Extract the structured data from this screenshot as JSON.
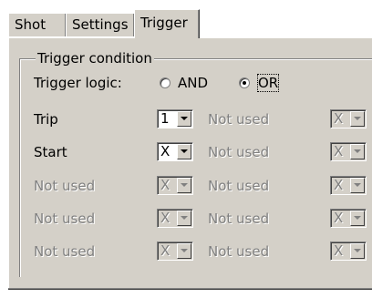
{
  "tabs": [
    {
      "label": "Shot",
      "active": false
    },
    {
      "label": "Settings",
      "active": false
    },
    {
      "label": "Trigger",
      "active": true
    }
  ],
  "group": {
    "title": "Trigger condition",
    "logic_label": "Trigger logic:",
    "logic_options": [
      {
        "label": "AND",
        "selected": false
      },
      {
        "label": "OR",
        "selected": true
      }
    ]
  },
  "rows": [
    {
      "name": "Trip",
      "enabled": true,
      "value": "1",
      "second_label": "Not used",
      "second_value": "X"
    },
    {
      "name": "Start",
      "enabled": true,
      "value": "X",
      "second_label": "Not used",
      "second_value": "X"
    },
    {
      "name": "Not used",
      "enabled": false,
      "value": "X",
      "second_label": "Not used",
      "second_value": "X"
    },
    {
      "name": "Not used",
      "enabled": false,
      "value": "X",
      "second_label": "Not used",
      "second_value": "X"
    },
    {
      "name": "Not used",
      "enabled": false,
      "value": "X",
      "second_label": "Not used",
      "second_value": "X"
    }
  ]
}
